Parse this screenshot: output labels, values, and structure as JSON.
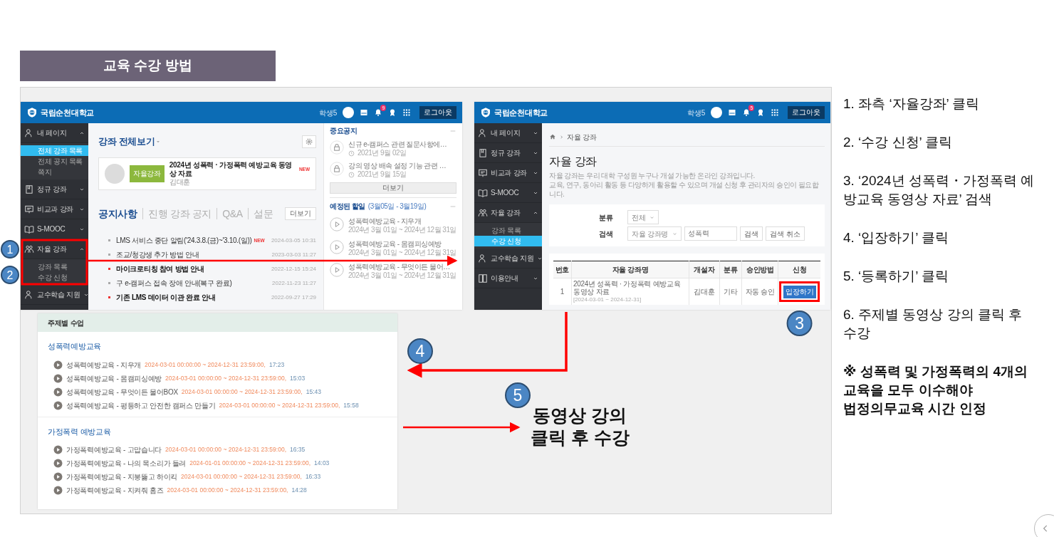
{
  "section_title": "교육 수강 방법",
  "main_screen": {
    "logo": "국립순천대학교",
    "user": "학생5",
    "notification_count": "9",
    "logout": "로그아웃",
    "sidebar": [
      {
        "label": "내 페이지",
        "expanded": true,
        "children": [
          {
            "label": "전체 강좌 목록",
            "selected": true
          },
          {
            "label": "전체 공지 목록",
            "selected": false
          },
          {
            "label": "쪽지",
            "selected": false
          }
        ]
      },
      {
        "label": "정규 강좌",
        "expanded": false
      },
      {
        "label": "비교과 강좌",
        "expanded": false
      },
      {
        "label": "S-MOOC",
        "expanded": false
      },
      {
        "label": "자율 강좌",
        "expanded": true,
        "children": [
          {
            "label": "강좌 목록",
            "selected": false
          },
          {
            "label": "수강 신청",
            "selected": false
          }
        ]
      },
      {
        "label": "교수학습 지원",
        "expanded": false
      }
    ],
    "heading": "강좌 전체보기",
    "course": {
      "tag": "자율강좌",
      "title": "2024년 성폭력 · 가정폭력 예방교육 동영상 자료",
      "new": "NEW",
      "teacher": "김대훈"
    },
    "tabs": [
      {
        "label": "공지사항",
        "selected": true
      },
      {
        "label": "진행 강좌 공지",
        "selected": false
      },
      {
        "label": "Q&A",
        "selected": false
      },
      {
        "label": "설문",
        "selected": false
      }
    ],
    "more": "더보기",
    "notices": [
      {
        "title": "LMS 서비스 중단 알림('24.3.8.(금)~'3.10.(일))",
        "new": "NEW",
        "date": "2024-03-05 10:31",
        "important": false
      },
      {
        "title": "조교/청강생 추가 방법 안내",
        "date": "2023-03-03 11:27",
        "important": false
      },
      {
        "title": "마이크로티칭 참여 방법 안내",
        "date": "2022-12-15 15:24",
        "important": true
      },
      {
        "title": "구 e-캠퍼스 접속 장애 안내(복구 완료)",
        "date": "2022-11-23 11:27",
        "important": false
      },
      {
        "title": "기존 LMS 데이터 이관 완료 안내",
        "date": "2022-09-27 17:29",
        "important": true
      }
    ],
    "side_panel": {
      "notice_title": "중요공지",
      "notices": [
        {
          "title": "신규 e-캠퍼스 관련 질문사항에…",
          "date": "2021년 9월 02일"
        },
        {
          "title": "강의 영상 배속 설정 기능 관련 …",
          "date": "2021년 9월 15일"
        }
      ],
      "more": "더보기",
      "todo_title": "예정된 할일",
      "todo_range": "(3월05일 - 3월19일)",
      "todos": [
        {
          "title": "성폭력예방교육 - 지우개",
          "period": "2024년 3월 01일 ~ 2024년 12월 31일"
        },
        {
          "title": "성폭력예방교육 - 몸캠피싱예방",
          "period": "2024년 3월 01일 ~ 2024년 12월 31일"
        },
        {
          "title": "성폭력예방교육 - 무엇이든 물어…",
          "period": "2024년 3월 01일 ~ 2024년 12월 31일"
        }
      ]
    }
  },
  "enroll_screen": {
    "logo": "국립순천대학교",
    "user": "학생5",
    "notification_count": "5",
    "logout": "로그아웃",
    "sidebar": [
      {
        "label": "내 페이지",
        "expanded": false
      },
      {
        "label": "정규 강좌",
        "expanded": false
      },
      {
        "label": "비교과 강좌",
        "expanded": false
      },
      {
        "label": "S-MOOC",
        "expanded": false
      },
      {
        "label": "자율 강좌",
        "expanded": true,
        "children": [
          {
            "label": "강좌 목록",
            "selected": false
          },
          {
            "label": "수강 신청",
            "selected": true
          }
        ]
      },
      {
        "label": "교수학습 지원",
        "expanded": false
      },
      {
        "label": "이용안내",
        "expanded": false
      }
    ],
    "breadcrumb": "자율 강좌",
    "title": "자율 강좌",
    "description": [
      "자율 강좌는 우리 대학 구성원 누구나 개설 가능한 온라인 강좌입니다.",
      "교육, 연구, 동아리 활동 등 다양하게 활용할 수 있으며 개설 신청 후 관리자의 승인이 필요합니다."
    ],
    "filter": {
      "category_label": "분류",
      "category_value": "전체",
      "search_label": "검색",
      "search_field": "자율 강좌명",
      "search_value": "성폭력",
      "search_button": "검색",
      "cancel_button": "검색 취소"
    },
    "table": {
      "columns": [
        "번호",
        "자율 강좌명",
        "개설자",
        "분류",
        "승인방법",
        "신청"
      ],
      "rows": [
        {
          "number": "1",
          "name": "2024년 성폭력 · 가정폭력 예방교육 동영상 자료",
          "period": "[2024-03-01 ~ 2024-12-31]",
          "owner": "김대훈",
          "category": "기타",
          "approval": "자동 승인",
          "action": "입장하기"
        }
      ]
    }
  },
  "course_screen": {
    "header": "주제별 수업",
    "sections": [
      {
        "title": "성폭력예방교육",
        "lessons": [
          {
            "title": "성폭력예방교육 - 지우개",
            "period": "2024-03-01 00:00:00 ~ 2024-12-31 23:59:00,",
            "duration": "17:23"
          },
          {
            "title": "성폭력예방교육 - 몸캠피싱예방",
            "period": "2024-03-01 00:00:00 ~ 2024-12-31 23:59:00,",
            "duration": "15:03"
          },
          {
            "title": "성폭력예방교육 - 무엇이든 물어BOX",
            "period": "2024-03-01 00:00:00 ~ 2024-12-31 23:59:00,",
            "duration": "15:43"
          },
          {
            "title": "성폭력예방교육 - 평등하고 안전한 캠퍼스 만들기",
            "period": "2024-03-01 00:00:00 ~ 2024-12-31 23:59:00,",
            "duration": "15:58"
          }
        ]
      },
      {
        "title": "가정폭력 예방교육",
        "lessons": [
          {
            "title": "가정폭력예방교육 - 고맙습니다",
            "period": "2024-03-01 00:00:00 ~ 2024-12-31 23:59:00,",
            "duration": "16:35"
          },
          {
            "title": "가정폭력예방교육 - 나의 목소리가 들려",
            "period": "2024-01-01 00:00:00 ~ 2024-12-31 23:59:00,",
            "duration": "14:03"
          },
          {
            "title": "가정폭력예방교육 - 지붕뚫고 하이킥",
            "period": "2024-03-01 00:00:00 ~ 2024-12-31 23:59:00,",
            "duration": "16:33"
          },
          {
            "title": "가정폭력예방교육 - 지켜줘 홈즈",
            "period": "2024-03-01 00:00:00 ~ 2024-12-31 23:59:00,",
            "duration": "14:28"
          }
        ]
      }
    ]
  },
  "callouts": [
    "1",
    "2",
    "3",
    "4",
    "5"
  ],
  "caption": [
    "동영상 강의",
    "클릭 후 수강"
  ],
  "steps": [
    "1. 좌측 ‘자율강좌’ 클릭",
    "2. ‘수강 신청’ 클릭",
    "3. ‘2024년 성폭력・가정폭력 예방교육 동영상 자료’ 검색",
    "4. ‘입장하기’ 클릭",
    "5. ‘등록하기’ 클릭",
    "6. 주제별 동영상 강의 클릭 후 수강"
  ],
  "note": [
    "※ 성폭력 및 가정폭력의 4개의",
    "교육을 모두 이수해야",
    "법정의무교육 시간 인정"
  ]
}
